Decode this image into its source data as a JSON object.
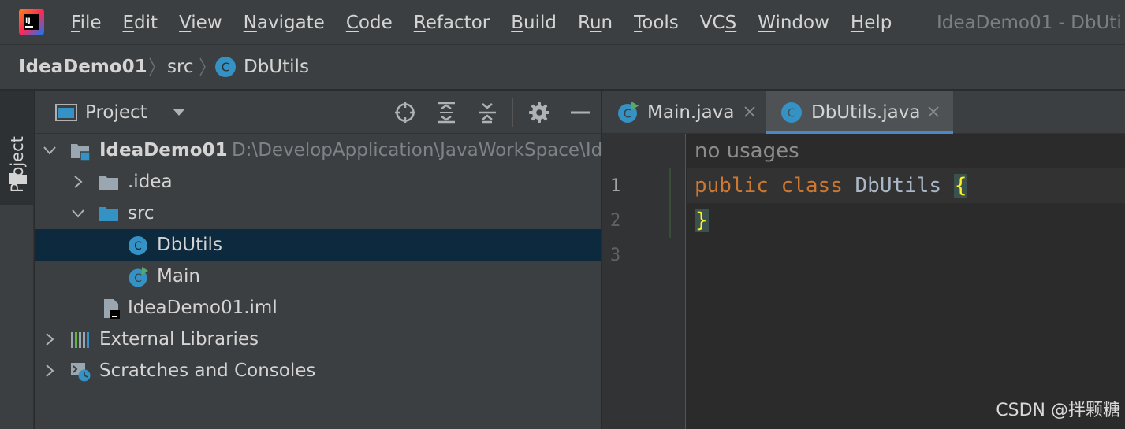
{
  "menubar": {
    "items": [
      {
        "label": "File",
        "mnemonic": "F",
        "rest": "ile"
      },
      {
        "label": "Edit",
        "mnemonic": "E",
        "rest": "dit"
      },
      {
        "label": "View",
        "mnemonic": "V",
        "rest": "iew"
      },
      {
        "label": "Navigate",
        "mnemonic": "N",
        "rest": "avigate"
      },
      {
        "label": "Code",
        "mnemonic": "C",
        "rest": "ode"
      },
      {
        "label": "Refactor",
        "mnemonic": "R",
        "rest": "efactor"
      },
      {
        "label": "Build",
        "mnemonic": "B",
        "rest": "uild"
      },
      {
        "label": "Run",
        "pre": "R",
        "mnemonic": "u",
        "rest": "n"
      },
      {
        "label": "Tools",
        "mnemonic": "T",
        "rest": "ools"
      },
      {
        "label": "VCS",
        "pre": "VC",
        "mnemonic": "S",
        "rest": ""
      },
      {
        "label": "Window",
        "mnemonic": "W",
        "rest": "indow"
      },
      {
        "label": "Help",
        "mnemonic": "H",
        "rest": "elp"
      }
    ],
    "window_title": "IdeaDemo01 - DbUti"
  },
  "breadcrumb": {
    "project": "IdeaDemo01",
    "folder": "src",
    "file": "DbUtils"
  },
  "tool_strip": {
    "project_label": "Project"
  },
  "project_panel": {
    "title": "Project",
    "tree": {
      "root_name": "IdeaDemo01",
      "root_path": "D:\\DevelopApplication\\JavaWorkSpace\\Id",
      "idea": ".idea",
      "src": "src",
      "dbutils": "DbUtils",
      "main": "Main",
      "iml": "IdeaDemo01.iml",
      "external": "External Libraries",
      "scratches": "Scratches and Consoles"
    }
  },
  "editor": {
    "tabs": [
      {
        "label": "Main.java",
        "active": false
      },
      {
        "label": "DbUtils.java",
        "active": true
      }
    ],
    "line_numbers": [
      "1",
      "2",
      "3"
    ],
    "inlay_hint": "no usages",
    "code": {
      "kw_public": "public",
      "kw_class": "class",
      "class_name": "DbUtils",
      "open_brace": "{",
      "close_brace": "}"
    }
  },
  "watermark": "CSDN @拌颗糖",
  "colors": {
    "accent": "#4a88c7",
    "selection": "#0d293e",
    "keyword": "#cc7832",
    "brace": "#ffef28",
    "folder_blue": "#3592c4"
  }
}
